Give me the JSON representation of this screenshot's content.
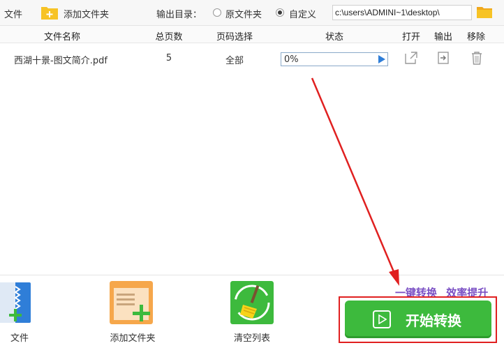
{
  "toolbar": {
    "add_file_label": "文件",
    "add_folder_label": "添加文件夹",
    "output_dir_label": "输出目录：",
    "output_options": [
      "原文件夹",
      "自定义"
    ],
    "output_selected": "自定义",
    "output_path": "c:\\users\\ADMINI~1\\desktop\\"
  },
  "table": {
    "headers": [
      "文件名称",
      "总页数",
      "页码选择",
      "状态",
      "打开",
      "输出",
      "移除"
    ],
    "rows": [
      {
        "name": "西湖十景-图文简介.pdf",
        "pages": "5",
        "page_selection": "全部",
        "status": "0%",
        "progress": 0
      }
    ]
  },
  "bottom": {
    "tools": [
      "文件",
      "添加文件夹",
      "清空列表"
    ],
    "slogan_part1": "一键转换",
    "slogan_part2": "效率提升",
    "start_label": "开始转换"
  },
  "colors": {
    "accent_green": "#3dba3d",
    "highlight_red": "#e02020",
    "slogan_purple": "#7a4fc4",
    "progress_border": "#8aa9c9"
  }
}
